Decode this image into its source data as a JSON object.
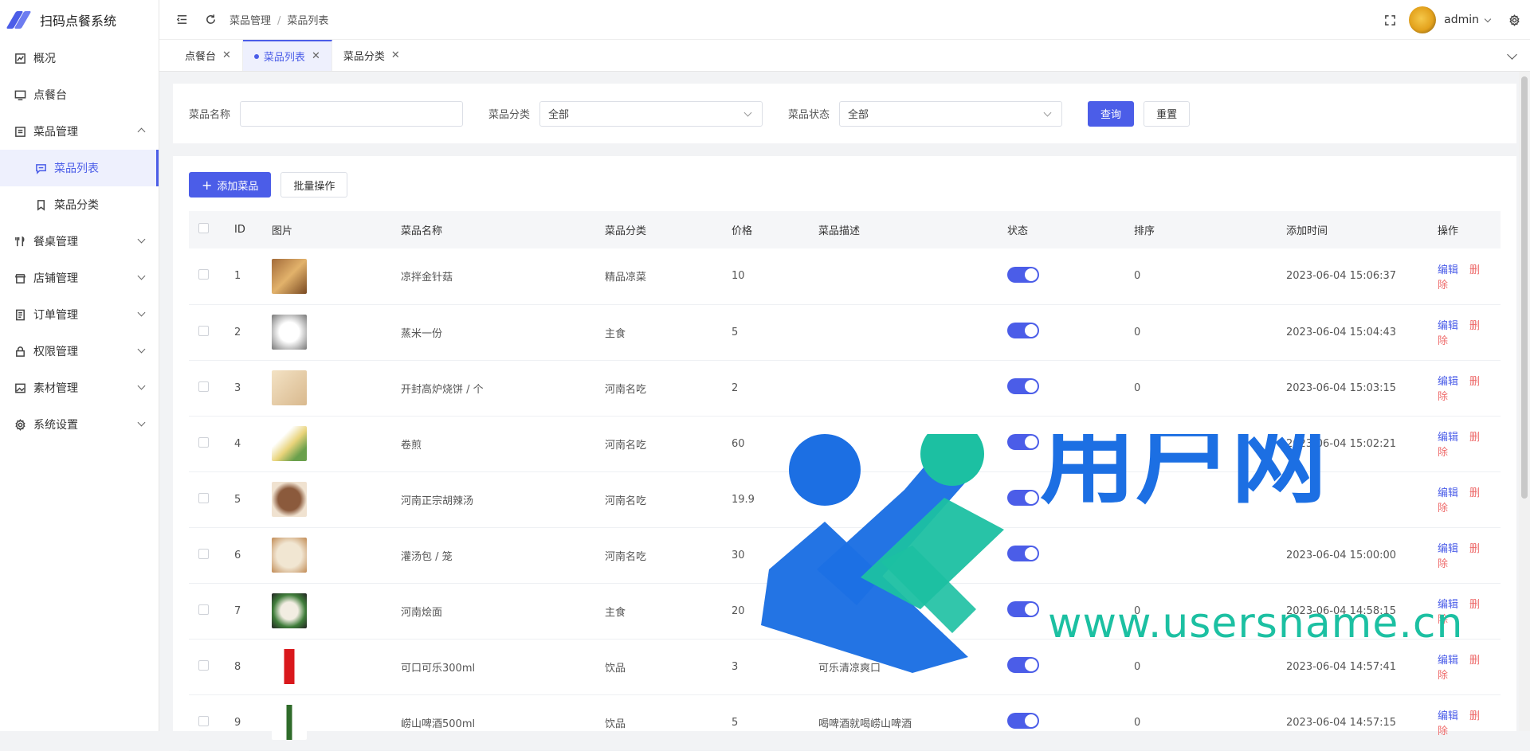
{
  "app": {
    "title": "扫码点餐系统"
  },
  "sidebar": {
    "items": [
      {
        "label": "概况",
        "icon": "dashboard-icon"
      },
      {
        "label": "点餐台",
        "icon": "monitor-icon"
      },
      {
        "label": "菜品管理",
        "icon": "menu-list-icon",
        "expanded": true
      },
      {
        "label": "菜品列表",
        "icon": "chat-icon",
        "sub": true,
        "active": true
      },
      {
        "label": "菜品分类",
        "icon": "bookmark-icon",
        "sub": true
      },
      {
        "label": "餐桌管理",
        "icon": "fork-knife-icon"
      },
      {
        "label": "店铺管理",
        "icon": "shop-icon"
      },
      {
        "label": "订单管理",
        "icon": "order-icon"
      },
      {
        "label": "权限管理",
        "icon": "lock-icon"
      },
      {
        "label": "素材管理",
        "icon": "image-icon"
      },
      {
        "label": "系统设置",
        "icon": "gear-icon"
      }
    ]
  },
  "header": {
    "breadcrumb": [
      "菜品管理",
      "菜品列表"
    ],
    "user": "admin"
  },
  "tabs": [
    {
      "label": "点餐台",
      "active": false
    },
    {
      "label": "菜品列表",
      "active": true
    },
    {
      "label": "菜品分类",
      "active": false
    }
  ],
  "filter": {
    "name_label": "菜品名称",
    "name_value": "",
    "category_label": "菜品分类",
    "category_value": "全部",
    "status_label": "菜品状态",
    "status_value": "全部",
    "query_button": "查询",
    "reset_button": "重置"
  },
  "toolbar": {
    "add_button": "添加菜品",
    "batch_button": "批量操作"
  },
  "table": {
    "columns": [
      "ID",
      "图片",
      "菜品名称",
      "菜品分类",
      "价格",
      "菜品描述",
      "状态",
      "排序",
      "添加时间",
      "操作"
    ],
    "rows": [
      {
        "id": "1",
        "name": "凉拌金针菇",
        "category": "精品凉菜",
        "price": "10",
        "desc": "",
        "status": true,
        "sort": "0",
        "time": "2023-06-04 15:06:37"
      },
      {
        "id": "2",
        "name": "蒸米一份",
        "category": "主食",
        "price": "5",
        "desc": "",
        "status": true,
        "sort": "0",
        "time": "2023-06-04 15:04:43"
      },
      {
        "id": "3",
        "name": "开封高炉烧饼 / 个",
        "category": "河南名吃",
        "price": "2",
        "desc": "",
        "status": true,
        "sort": "0",
        "time": "2023-06-04 15:03:15"
      },
      {
        "id": "4",
        "name": "卷煎",
        "category": "河南名吃",
        "price": "60",
        "desc": "",
        "status": true,
        "sort": "",
        "time": "2023-06-04 15:02:21"
      },
      {
        "id": "5",
        "name": "河南正宗胡辣汤",
        "category": "河南名吃",
        "price": "19.9",
        "desc": "",
        "status": true,
        "sort": "",
        "time": ""
      },
      {
        "id": "6",
        "name": "灌汤包 / 笼",
        "category": "河南名吃",
        "price": "30",
        "desc": "",
        "status": true,
        "sort": "",
        "time": "2023-06-04 15:00:00"
      },
      {
        "id": "7",
        "name": "河南烩面",
        "category": "主食",
        "price": "20",
        "desc": "",
        "status": true,
        "sort": "0",
        "time": "2023-06-04 14:58:15"
      },
      {
        "id": "8",
        "name": "可口可乐300ml",
        "category": "饮品",
        "price": "3",
        "desc": "可乐清凉爽口",
        "status": true,
        "sort": "0",
        "time": "2023-06-04 14:57:41"
      },
      {
        "id": "9",
        "name": "崂山啤酒500ml",
        "category": "饮品",
        "price": "5",
        "desc": "喝啤酒就喝崂山啤酒",
        "status": true,
        "sort": "0",
        "time": "2023-06-04 14:57:15"
      }
    ],
    "edit_label": "编辑",
    "delete_label": "删除"
  },
  "watermark": {
    "brand": "用户网",
    "url": "www.usersname.cn"
  },
  "colors": {
    "accent": "#4b5de8",
    "danger": "#ee6a6a",
    "wm_blue": "#1c6fe3",
    "wm_green": "#1cc0a2"
  }
}
